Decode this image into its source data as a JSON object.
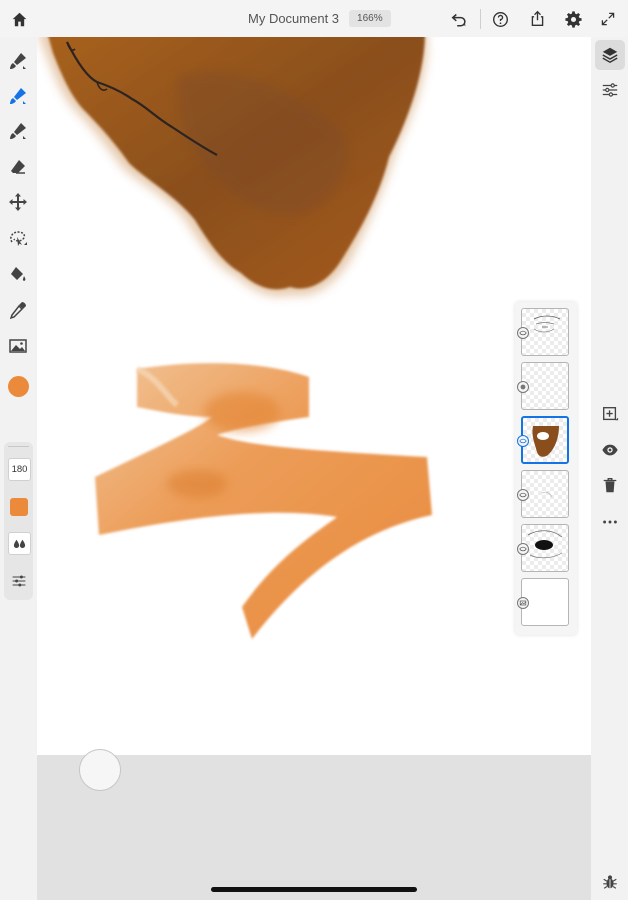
{
  "header": {
    "title": "My Document 3",
    "zoom": "166%"
  },
  "icons": {
    "home": "home-icon",
    "undo": "undo-icon",
    "help": "help-icon",
    "share": "share-icon",
    "settings": "gear-icon",
    "fullscreen": "expand-icon"
  },
  "tools": [
    "pixel-brush-icon",
    "live-brush-icon",
    "vector-brush-icon",
    "eraser-icon",
    "move-icon",
    "lasso-icon",
    "fill-icon",
    "eyedropper-icon",
    "image-icon"
  ],
  "color": {
    "current": "#ec8a3c"
  },
  "brush": {
    "size": "180",
    "color": "#ec8a3c"
  },
  "right_tools": [
    "layers-icon",
    "layer-properties-icon",
    "add-layer-icon",
    "visibility-icon",
    "delete-icon",
    "more-icon",
    "bug-report-icon"
  ],
  "layers": [
    {
      "name": "sketch layer",
      "selected": false
    },
    {
      "name": "empty layer",
      "selected": false
    },
    {
      "name": "brown paint layer",
      "selected": true
    },
    {
      "name": "light sketch layer",
      "selected": false
    },
    {
      "name": "eye sketch layer",
      "selected": false
    },
    {
      "name": "background layer",
      "selected": false
    }
  ]
}
